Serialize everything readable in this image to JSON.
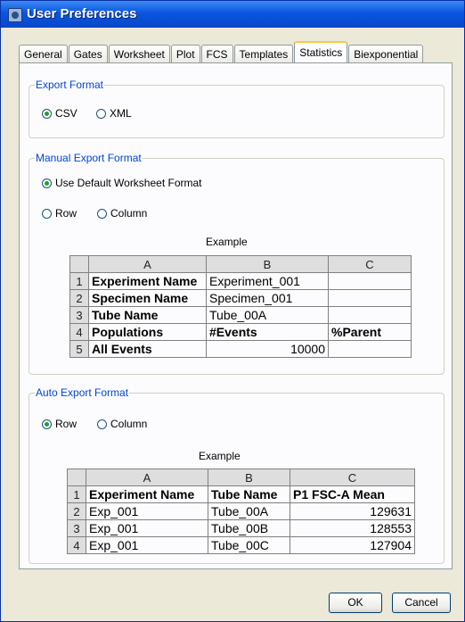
{
  "window": {
    "title": "User Preferences"
  },
  "tabs": [
    "General",
    "Gates",
    "Worksheet",
    "Plot",
    "FCS",
    "Templates",
    "Statistics",
    "Biexponential"
  ],
  "active_tab": "Statistics",
  "export_format": {
    "legend": "Export Format",
    "options": [
      "CSV",
      "XML"
    ],
    "selected": "CSV"
  },
  "manual_export": {
    "legend": "Manual Export Format",
    "use_default_label": "Use Default Worksheet Format",
    "row_label": "Row",
    "column_label": "Column",
    "example_label": "Example",
    "columns": [
      "A",
      "B",
      "C"
    ],
    "rows": [
      {
        "num": "1",
        "a": "Experiment Name",
        "b": "Experiment_001",
        "c": ""
      },
      {
        "num": "2",
        "a": "Specimen Name",
        "b": "Specimen_001",
        "c": ""
      },
      {
        "num": "3",
        "a": "Tube Name",
        "b": "Tube_00A",
        "c": ""
      },
      {
        "num": "4",
        "a": "Populations",
        "b": "#Events",
        "c": "%Parent"
      },
      {
        "num": "5",
        "a": "All Events",
        "b": "10000",
        "c": ""
      }
    ]
  },
  "auto_export": {
    "legend": "Auto Export Format",
    "row_label": "Row",
    "column_label": "Column",
    "selected": "Row",
    "example_label": "Example",
    "columns": [
      "A",
      "B",
      "C"
    ],
    "rows": [
      {
        "num": "1",
        "a": "Experiment Name",
        "b": "Tube Name",
        "c": "P1 FSC-A Mean"
      },
      {
        "num": "2",
        "a": "Exp_001",
        "b": "Tube_00A",
        "c": "129631"
      },
      {
        "num": "3",
        "a": "Exp_001",
        "b": "Tube_00B",
        "c": "128553"
      },
      {
        "num": "4",
        "a": "Exp_001",
        "b": "Tube_00C",
        "c": "127904"
      }
    ]
  },
  "buttons": {
    "ok": "OK",
    "cancel": "Cancel"
  }
}
